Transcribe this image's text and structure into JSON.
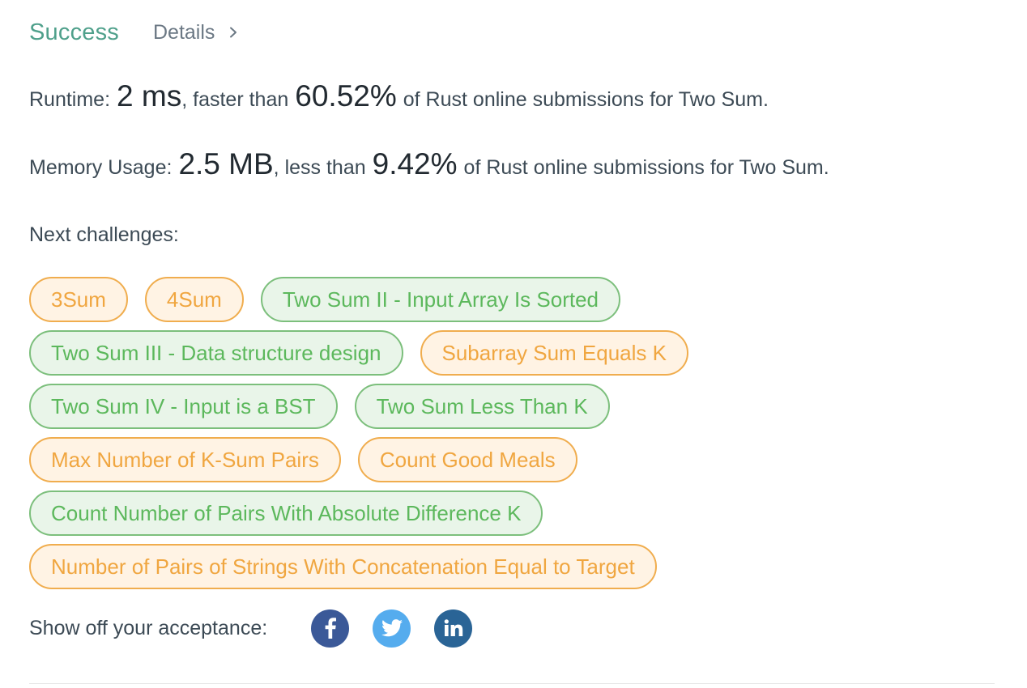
{
  "result": {
    "status": "Success",
    "details_label": "Details"
  },
  "runtime": {
    "label": "Runtime:",
    "value": "2 ms",
    "comparison": ", faster than",
    "percent": "60.52%",
    "tail": "of Rust online submissions for Two Sum."
  },
  "memory": {
    "label": "Memory Usage:",
    "value": "2.5 MB",
    "comparison": ", less than",
    "percent": "9.42%",
    "tail": "of Rust online submissions for Two Sum."
  },
  "next": {
    "label": "Next challenges:",
    "challenges": [
      {
        "title": "3Sum",
        "difficulty": "medium"
      },
      {
        "title": "4Sum",
        "difficulty": "medium"
      },
      {
        "title": "Two Sum II - Input Array Is Sorted",
        "difficulty": "easy"
      },
      {
        "title": "Two Sum III - Data structure design",
        "difficulty": "easy"
      },
      {
        "title": "Subarray Sum Equals K",
        "difficulty": "medium"
      },
      {
        "title": "Two Sum IV - Input is a BST",
        "difficulty": "easy"
      },
      {
        "title": "Two Sum Less Than K",
        "difficulty": "easy"
      },
      {
        "title": "Max Number of K-Sum Pairs",
        "difficulty": "medium"
      },
      {
        "title": "Count Good Meals",
        "difficulty": "medium"
      },
      {
        "title": "Count Number of Pairs With Absolute Difference K",
        "difficulty": "easy"
      },
      {
        "title": "Number of Pairs of Strings With Concatenation Equal to Target",
        "difficulty": "medium"
      }
    ]
  },
  "share": {
    "label": "Show off your acceptance:",
    "icons": [
      "facebook-icon",
      "twitter-icon",
      "linkedin-icon"
    ]
  },
  "colors": {
    "success": "#4fa08b",
    "medium_border": "#f0ad4e",
    "medium_bg": "#fff3e4",
    "easy_border": "#7cbf7c",
    "easy_bg": "#e9f5e9",
    "facebook": "#3b5998",
    "twitter": "#55acee",
    "linkedin": "#2a6496"
  }
}
